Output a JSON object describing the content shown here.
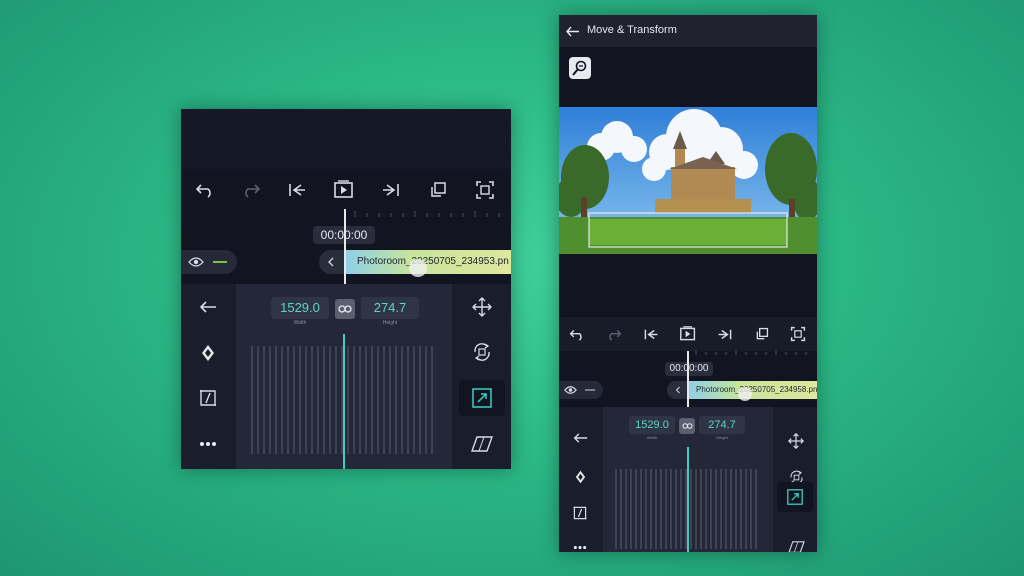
{
  "colors": {
    "background": "#2bb786",
    "panel": "#121521",
    "accent": "#3bd0c0",
    "value_text": "#5fd3c6"
  },
  "toolbar": {
    "icons": [
      "undo-icon",
      "redo-icon",
      "skip-to-start-icon",
      "play-icon",
      "skip-to-end-icon",
      "copy-icon",
      "fullscreen-icon"
    ]
  },
  "left": {
    "timestamp": "00:00:00",
    "clip_name": "Photoroom_20250705_234953.pn",
    "width_value": "1529.0",
    "height_value": "274.7",
    "width_label": "Width",
    "height_label": "Height",
    "left_tools": [
      "back-arrow-icon",
      "keyframe-icon",
      "crop-icon",
      "more-icon"
    ],
    "right_tools": [
      "move-icon",
      "rotate-icon",
      "resize-icon",
      "skew-icon"
    ]
  },
  "right": {
    "header_title": "Move & Transform",
    "timestamp": "00:00:00",
    "clip_name": "Photoroom_20250705_234958.pn",
    "width_value": "1529.0",
    "height_value": "274.7",
    "width_label": "Width",
    "height_label": "Height"
  }
}
